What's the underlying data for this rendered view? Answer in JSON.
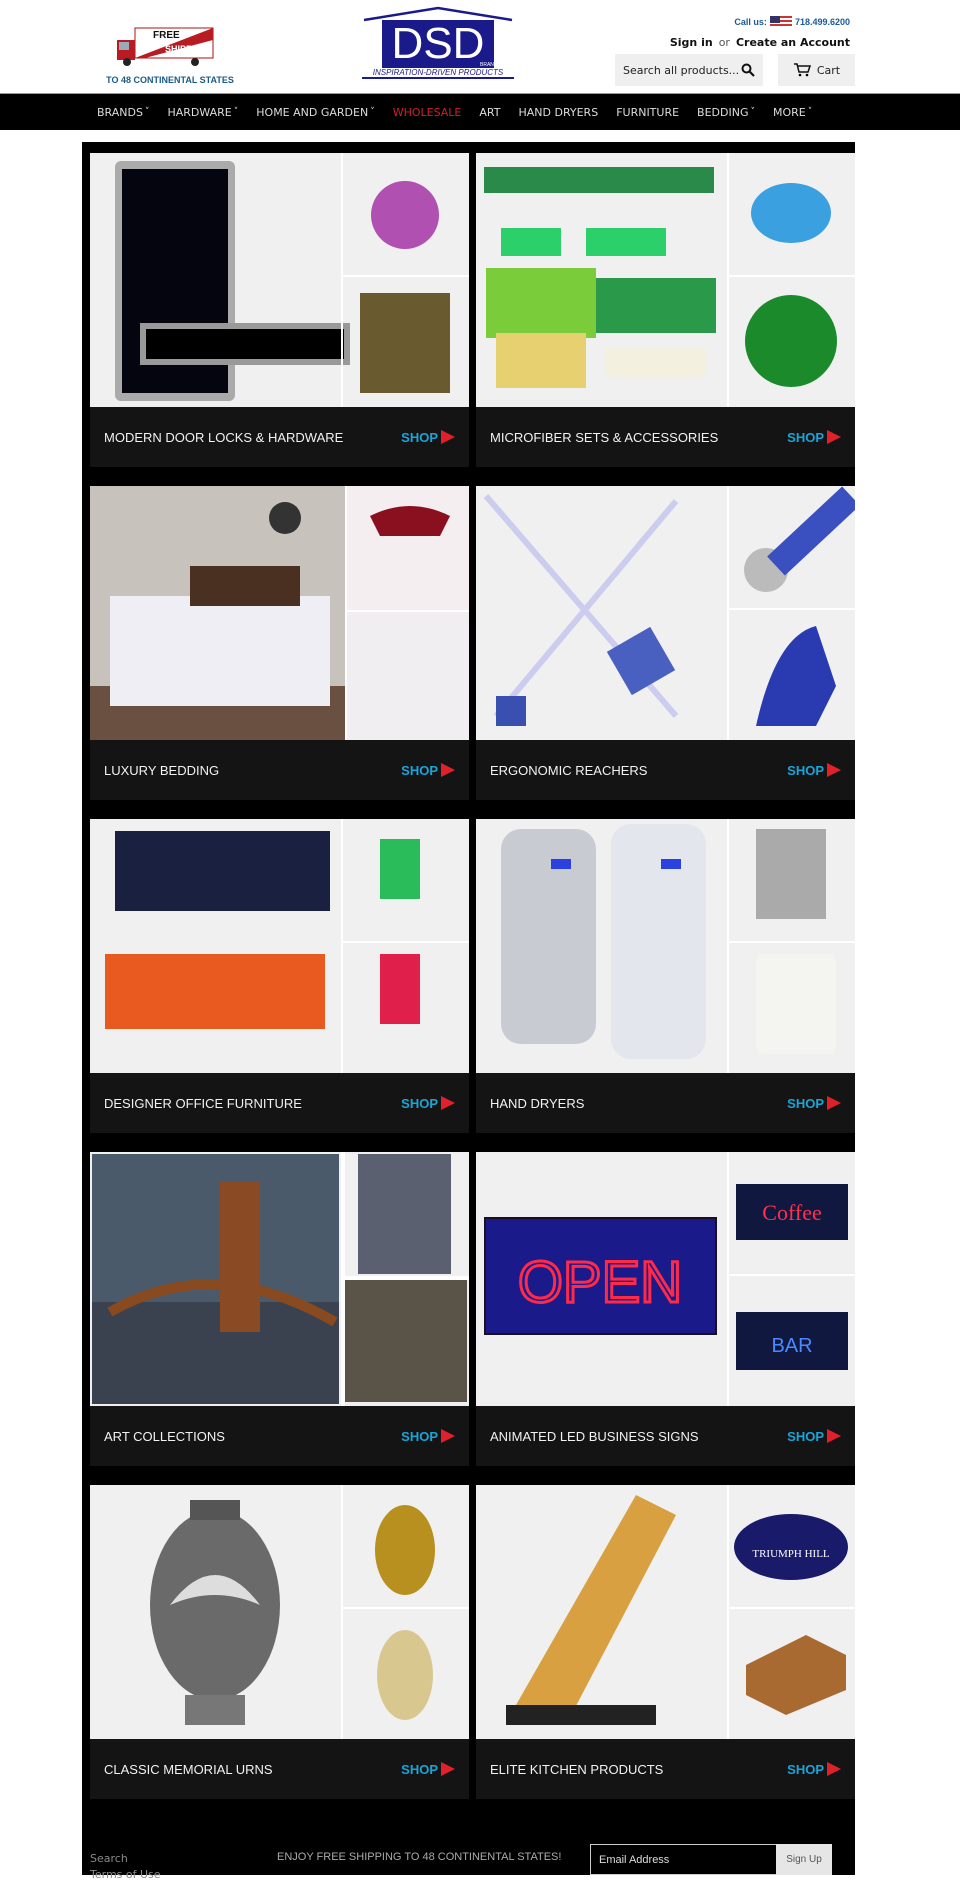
{
  "header": {
    "shipping_badge": {
      "line1": "FREE",
      "line2": "SHIPPING",
      "caption": "TO 48 CONTINENTAL STATES"
    },
    "logo": {
      "text": "DSD",
      "sub": "BRANDS",
      "tagline": "INSPIRATION-DRIVEN PRODUCTS"
    },
    "call_label": "Call us:",
    "phone": "718.499.6200",
    "sign_in": "Sign in",
    "or": "or",
    "create_account": "Create an Account",
    "search_placeholder": "Search all products...",
    "cart_label": "Cart"
  },
  "nav": [
    {
      "label": "BRANDS",
      "dropdown": true
    },
    {
      "label": "HARDWARE",
      "dropdown": true
    },
    {
      "label": "HOME AND GARDEN",
      "dropdown": true
    },
    {
      "label": "WHOLESALE",
      "dropdown": false,
      "highlight": "#d0202a"
    },
    {
      "label": "ART",
      "dropdown": false
    },
    {
      "label": "HAND DRYERS",
      "dropdown": false
    },
    {
      "label": "FURNITURE",
      "dropdown": false
    },
    {
      "label": "BEDDING",
      "dropdown": true
    },
    {
      "label": "MORE",
      "dropdown": true
    }
  ],
  "tiles": [
    {
      "title": "MODERN DOOR LOCKS & HARDWARE",
      "shop": "SHOP"
    },
    {
      "title": "MICROFIBER SETS & ACCESSORIES",
      "shop": "SHOP"
    },
    {
      "title": "LUXURY BEDDING",
      "shop": "SHOP"
    },
    {
      "title": "ERGONOMIC REACHERS",
      "shop": "SHOP"
    },
    {
      "title": "DESIGNER OFFICE FURNITURE",
      "shop": "SHOP"
    },
    {
      "title": "HAND DRYERS",
      "shop": "SHOP"
    },
    {
      "title": "ART COLLECTIONS",
      "shop": "SHOP"
    },
    {
      "title": "ANIMATED LED BUSINESS SIGNS",
      "shop": "SHOP"
    },
    {
      "title": "CLASSIC MEMORIAL URNS",
      "shop": "SHOP"
    },
    {
      "title": "ELITE KITCHEN PRODUCTS",
      "shop": "SHOP"
    }
  ],
  "footer": {
    "links": [
      "Search",
      "Terms of Use"
    ],
    "promo": "ENJOY FREE SHIPPING TO 48 CONTINENTAL STATES!",
    "email_placeholder": "Email Address",
    "signup": "Sign Up"
  },
  "colors": {
    "accent_shop": "#1aa4d8",
    "arrow": "#e0202a",
    "nav_bg": "#000000",
    "brand_blue": "#1a1a8a"
  }
}
